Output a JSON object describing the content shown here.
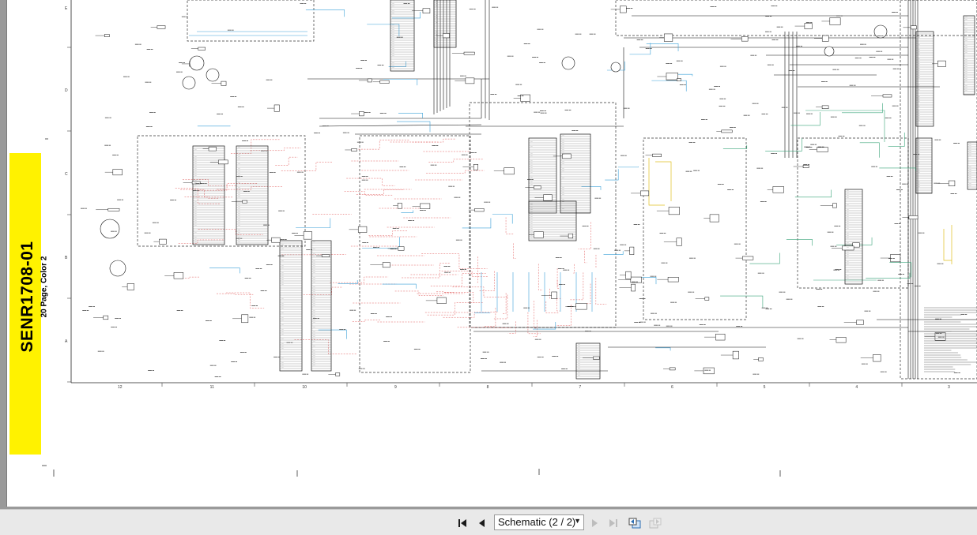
{
  "document": {
    "banner_code": "SENR1708-01",
    "banner_subtitle": "20 Page, Color 2",
    "banner_color": "#fff200",
    "column_numbers": [
      "12",
      "11",
      "10",
      "9",
      "8",
      "7",
      "6",
      "5",
      "4",
      "3"
    ],
    "row_letters": [
      "E",
      "D",
      "C",
      "B",
      "A"
    ],
    "wire_colors": {
      "red": "#e05a5a",
      "blue": "#3aa0d8",
      "green": "#3aa57a",
      "yellow": "#e0c020",
      "black": "#111111"
    }
  },
  "toolbar": {
    "page_select_value": "Schematic (2 / 2)",
    "first_icon": "first-page-icon",
    "prev_icon": "previous-page-icon",
    "next_icon": "next-page-icon",
    "last_icon": "last-page-icon",
    "back_icon": "go-back-icon",
    "forward_icon": "go-forward-icon"
  }
}
